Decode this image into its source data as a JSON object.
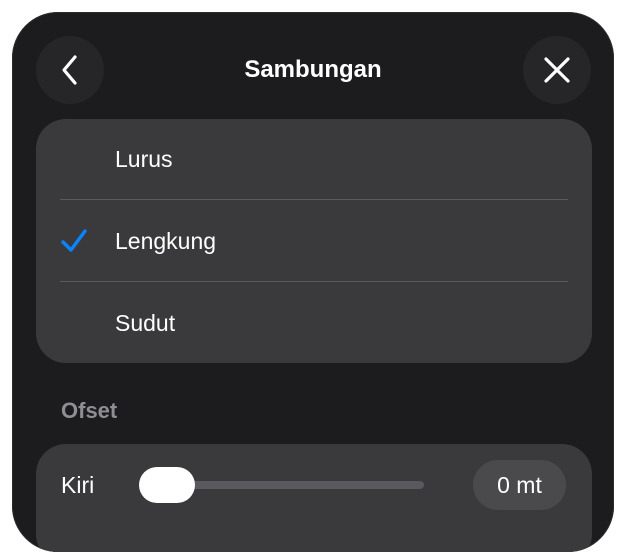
{
  "header": {
    "title": "Sambungan",
    "back_icon": "chevron-left-icon",
    "close_icon": "close-icon"
  },
  "options": {
    "items": [
      {
        "label": "Lurus",
        "selected": false
      },
      {
        "label": "Lengkung",
        "selected": true
      },
      {
        "label": "Sudut",
        "selected": false
      }
    ],
    "check_icon": "checkmark-icon"
  },
  "offset": {
    "section_label": "Ofset",
    "left": {
      "label": "Kiri",
      "value_text": "0 mt",
      "value": 0
    }
  },
  "colors": {
    "panel": "#1c1c1e",
    "group": "#3a3a3c",
    "accent": "#0a84ff",
    "muted_text": "#8e8e93"
  }
}
